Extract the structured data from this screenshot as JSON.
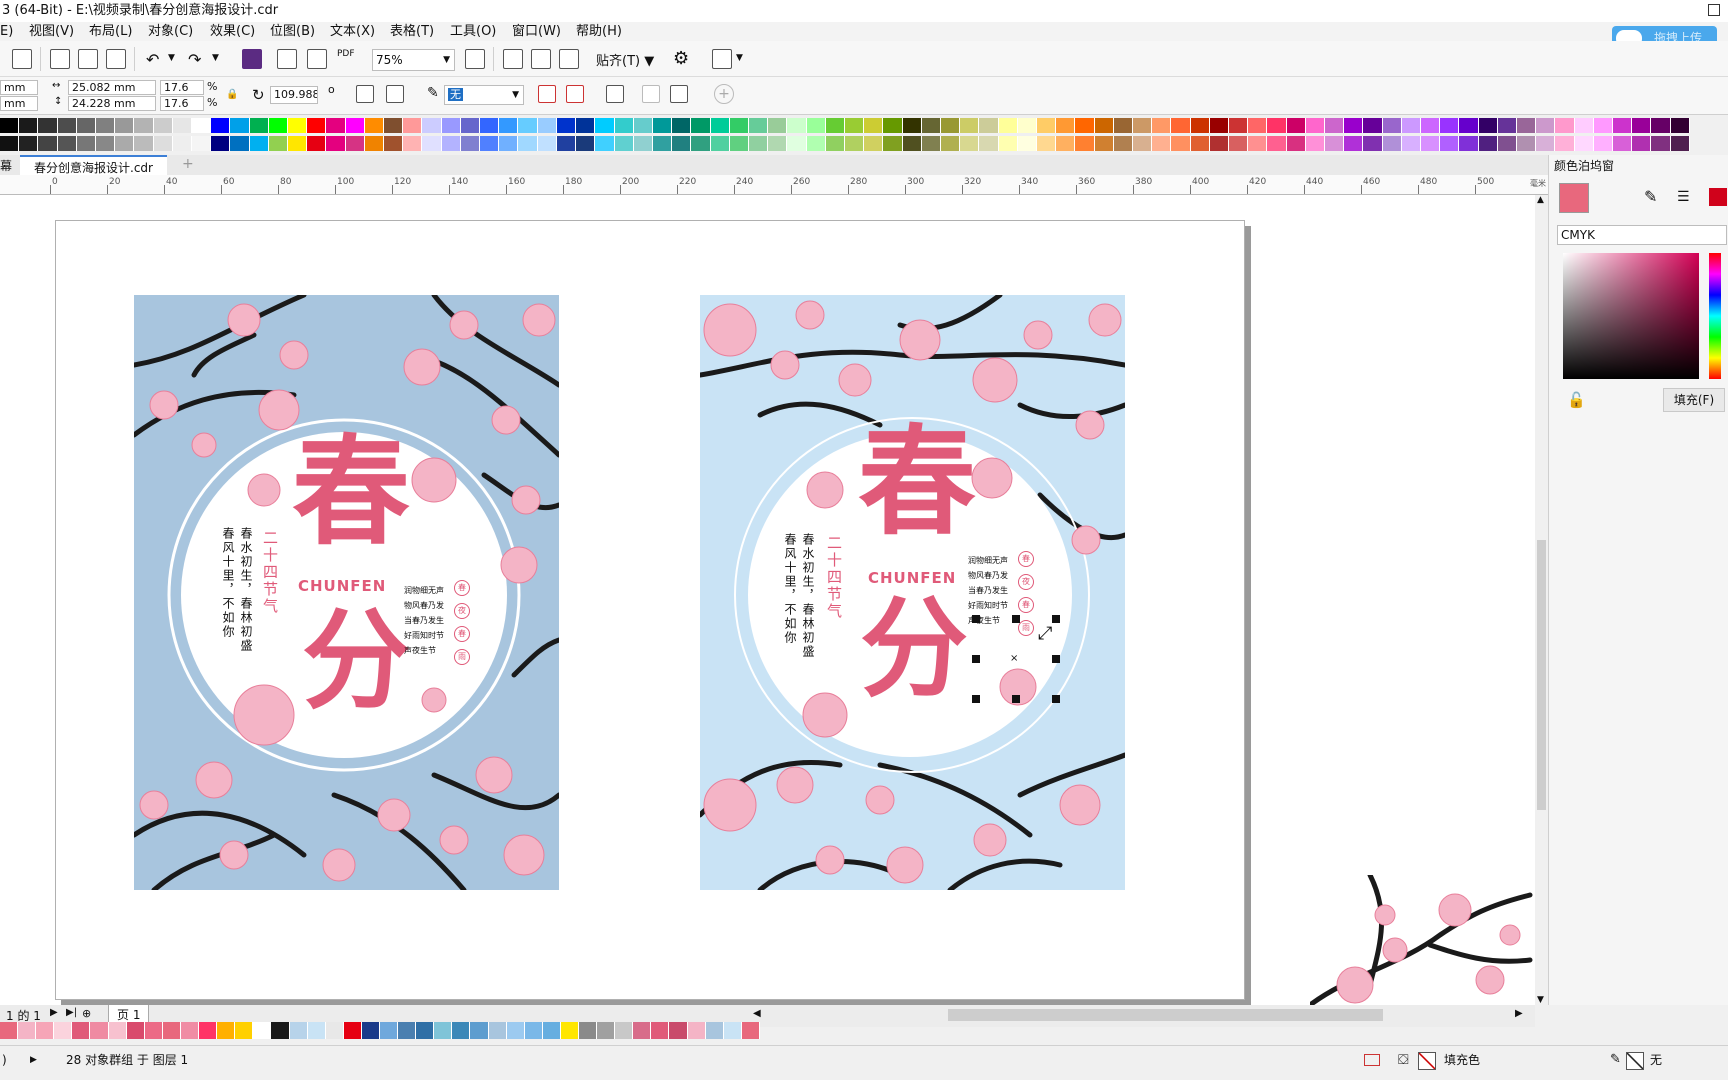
{
  "window": {
    "title": "3 (64-Bit) - E:\\视频录制\\春分创意海报设计.cdr",
    "upload_button": "拖拽上传"
  },
  "menu": [
    "E)",
    "视图(V)",
    "布局(L)",
    "对象(C)",
    "效果(C)",
    "位图(B)",
    "文本(X)",
    "表格(T)",
    "工具(O)",
    "窗口(W)",
    "帮助(H)"
  ],
  "toolbar": {
    "zoom": "75%",
    "snap_label": "贴齐(T)",
    "pdf_label": "PDF"
  },
  "propbar": {
    "pos_x_unit": "mm",
    "pos_y_unit": "mm",
    "width": "25.082 mm",
    "height": "24.228 mm",
    "scale_x": "17.6",
    "scale_y": "17.6",
    "percent": "%",
    "rotation": "109.988",
    "degree": "o",
    "outline": "无"
  },
  "tabs": {
    "left_stub": "幕",
    "doc_tab": "春分创意海报设计.cdr",
    "add": "+"
  },
  "ruler": {
    "ticks": [
      "0",
      "20",
      "40",
      "60",
      "80",
      "100",
      "120",
      "140",
      "160",
      "180",
      "200",
      "220",
      "240",
      "260",
      "280",
      "300",
      "320",
      "340",
      "360",
      "380",
      "400",
      "420",
      "440",
      "460",
      "480",
      "500"
    ],
    "unit": "毫米"
  },
  "colors": {
    "poster1_bg": "#a8c5de",
    "poster2_bg": "#c9e3f5",
    "pink": "#e05a79",
    "blossom": "#f4b4c6",
    "branch": "#1a1a1a",
    "accent_current": "#e8687d"
  },
  "palette_top": [
    "#000000",
    "#1a1a1a",
    "#333333",
    "#4d4d4d",
    "#666666",
    "#808080",
    "#999999",
    "#b3b3b3",
    "#cccccc",
    "#e6e6e6",
    "#ffffff",
    "#0000ff",
    "#00a0e9",
    "#00b050",
    "#00ff00",
    "#ffff00",
    "#ff0000",
    "#e4007f",
    "#ff00ff",
    "#ff8c00",
    "#7f4f2f",
    "#ff9999",
    "#ccccff",
    "#9999ff",
    "#6666cc",
    "#3366ff",
    "#3399ff",
    "#66ccff",
    "#99ccff",
    "#0033cc",
    "#003399",
    "#00ccff",
    "#33cccc",
    "#66cccc",
    "#009999",
    "#006666",
    "#009966",
    "#00cc99",
    "#33cc66",
    "#66cc99",
    "#99cc99",
    "#ccffcc",
    "#99ff99",
    "#66cc33",
    "#99cc33",
    "#cccc33",
    "#669900",
    "#333300",
    "#666633",
    "#999933",
    "#cccc66",
    "#cccc99",
    "#ffff99",
    "#ffffcc",
    "#ffcc66",
    "#ff9933",
    "#ff6600",
    "#cc6600",
    "#996633",
    "#cc9966",
    "#ff9966",
    "#ff6633",
    "#cc3300",
    "#990000",
    "#cc3333",
    "#ff6666",
    "#ff3366",
    "#cc0066",
    "#ff66cc",
    "#cc66cc",
    "#9900cc",
    "#660099",
    "#9966cc",
    "#cc99ff",
    "#cc66ff",
    "#9933ff",
    "#6600cc",
    "#330066",
    "#663399",
    "#996699",
    "#cc99cc",
    "#ff99cc",
    "#ffccff",
    "#ff99ff",
    "#cc33cc",
    "#990099",
    "#660066",
    "#330033"
  ],
  "palette_top2": [
    "#111111",
    "#222222",
    "#444444",
    "#555555",
    "#777777",
    "#888888",
    "#aaaaaa",
    "#bbbbbb",
    "#dddddd",
    "#eeeeee",
    "#f5f5f5",
    "#000080",
    "#0070c0",
    "#00b0f0",
    "#92d050",
    "#ffe600",
    "#e60012",
    "#e4007f",
    "#d63384",
    "#f08300",
    "#a0522d",
    "#ffb3b3",
    "#e0e0ff",
    "#b3b3ff",
    "#8080d0",
    "#5080ff",
    "#70b0ff",
    "#a0d8ff",
    "#c0e0ff",
    "#2040a0",
    "#1a3a7a",
    "#40d0ff",
    "#60d0d0",
    "#90d0d0",
    "#30a0a0",
    "#208080",
    "#30a080",
    "#50d0a0",
    "#60d080",
    "#90d0a0",
    "#b0d8b0",
    "#e0ffe0",
    "#b0ffb0",
    "#90d060",
    "#b0d060",
    "#d0d060",
    "#80a020",
    "#505020",
    "#808050",
    "#b0b050",
    "#d8d890",
    "#d8d8b0",
    "#ffffb0",
    "#ffffe0",
    "#ffd890",
    "#ffb060",
    "#ff8030",
    "#d08030",
    "#b08050",
    "#d8b090",
    "#ffb090",
    "#ff9060",
    "#e06030",
    "#b03030",
    "#d86060",
    "#ff9090",
    "#ff6090",
    "#d83080",
    "#ff90d8",
    "#d890d8",
    "#b030d8",
    "#8030b0",
    "#b090d8",
    "#d8b0ff",
    "#d890ff",
    "#b060ff",
    "#8030d8",
    "#502080",
    "#805090",
    "#b090b0",
    "#d8b0d8",
    "#ffb0d8",
    "#ffd8ff",
    "#ffb0ff",
    "#d860d8",
    "#b030b0",
    "#803080",
    "#502050"
  ],
  "palette_bottom": [
    "#e8687d",
    "#f4b4c6",
    "#f6a5b7",
    "#fbd3dd",
    "#e05a79",
    "#ef8aa2",
    "#f7c1cf",
    "#d94a6c",
    "#ec6a86",
    "#e8687d",
    "#f08ca4",
    "#ff3366",
    "#ffb000",
    "#ffd000",
    "#ffffff",
    "#1a1a1a",
    "#b7d3ea",
    "#c9e3f5",
    "#e8e8e8",
    "#e60012",
    "#1a3a8a",
    "#6fa8dc",
    "#4a7fb0",
    "#2f6fa6",
    "#7fc4d8",
    "#3b88b8",
    "#5d9dcf",
    "#a8c5de",
    "#9ccaf0",
    "#7ab8e8",
    "#66aee0",
    "#ffe600",
    "#8a8a8a",
    "#a0a0a0",
    "#c8c8c8",
    "#d86c8a",
    "#e05a79",
    "#c94a6b",
    "#f4b4c6",
    "#a8c5de",
    "#c9e3f5",
    "#e8687d"
  ],
  "dock": {
    "title": "颜色泊坞窗",
    "color_model": "CMYK",
    "fill_button": "填充(F)"
  },
  "bottom": {
    "page_info": "1 的 1",
    "page_tab": "页 1"
  },
  "status": {
    "left_marker": ")",
    "message": "28 对象群组 于 图层 1",
    "fill_label": "填充色",
    "outline_label": "无"
  },
  "poster1": {
    "big1": "春",
    "big2": "分",
    "pinyin": "CHUNFEN",
    "term": "二十四节气",
    "poem": [
      "春水初生，春林初盛",
      "春风十里，不如你"
    ],
    "small_lines": [
      "润物细无声",
      "物风春乃发",
      "当春乃发生",
      "好雨知时节",
      "声夜生节"
    ],
    "circles": [
      "春",
      "夜",
      "春",
      "雨"
    ]
  },
  "poster2": {
    "big1": "春",
    "big2": "分",
    "pinyin": "CHUNFEN",
    "term": "二十四节气",
    "poem": [
      "春水初生，春林初盛",
      "春风十里，不如你"
    ],
    "small_lines": [
      "润物细无声",
      "物风春乃发",
      "当春乃发生",
      "好雨知时节",
      "声夜生节"
    ],
    "circles": [
      "春",
      "夜",
      "春",
      "雨"
    ]
  }
}
